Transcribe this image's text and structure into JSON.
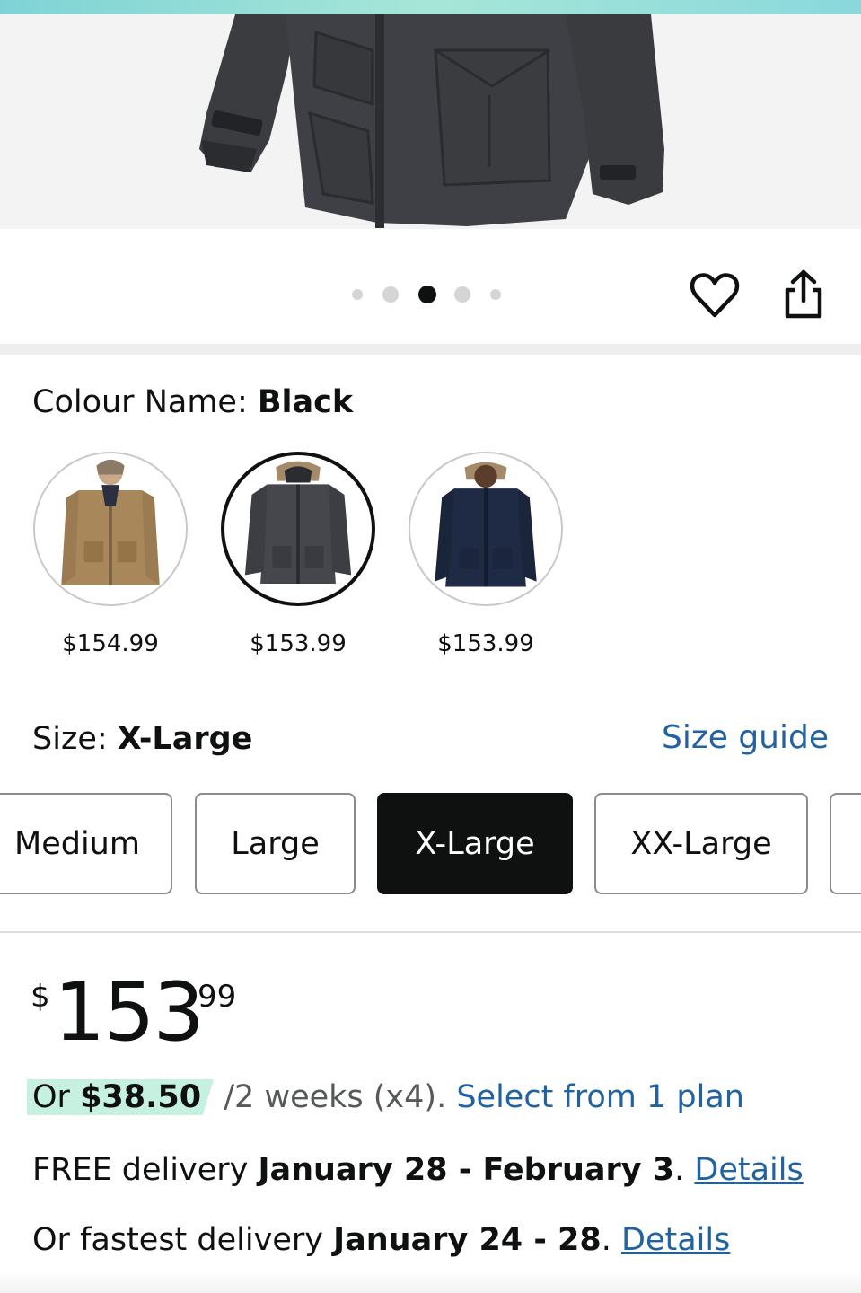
{
  "gallery": {
    "dots_count": 5,
    "active_dot": 3
  },
  "actions": {
    "wishlist_icon": "heart-icon",
    "share_icon": "share-icon"
  },
  "colour": {
    "label": "Colour Name: ",
    "value": "Black",
    "options": [
      {
        "name": "Tan",
        "price": "$154.99",
        "selected": false
      },
      {
        "name": "Black",
        "price": "$153.99",
        "selected": true
      },
      {
        "name": "Navy",
        "price": "$153.99",
        "selected": false
      }
    ]
  },
  "size": {
    "label": "Size: ",
    "value": "X-Large",
    "guide_link": "Size guide",
    "options": [
      {
        "label": "Medium",
        "selected": false
      },
      {
        "label": "Large",
        "selected": false
      },
      {
        "label": "X-Large",
        "selected": true
      },
      {
        "label": "XX-Large",
        "selected": false
      }
    ]
  },
  "price": {
    "symbol": "$",
    "whole": "153",
    "fraction": "99"
  },
  "installments": {
    "prefix": "Or ",
    "amount": "$38.50",
    "terms": " /2 weeks (x4). ",
    "link": "Select from 1 plan"
  },
  "delivery": {
    "free_prefix": "FREE delivery ",
    "free_dates": "January 28 - February 3",
    "free_suffix": ". ",
    "free_link": "Details",
    "fast_prefix": "Or fastest delivery ",
    "fast_dates": "January 24 - 28",
    "fast_suffix": ". ",
    "fast_link": "Details"
  },
  "colors": {
    "link": "#2162a1",
    "text": "#0f1111",
    "installment_highlight": "#c6f0e0",
    "selected_size_bg": "#0f1111"
  }
}
